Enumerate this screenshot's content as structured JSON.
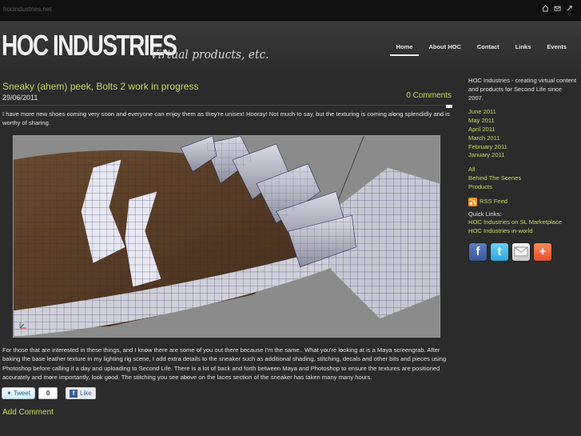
{
  "topbar": {
    "site": "hocindustries.net",
    "icons": [
      "home-icon",
      "mail-icon",
      "link-icon"
    ]
  },
  "header": {
    "logo": "HOC INDUSTRIES",
    "tagline": "Virtual products, etc.",
    "nav": [
      "Home",
      "About HOC",
      "Contact",
      "Links",
      "Events"
    ],
    "active_nav": "Home"
  },
  "post": {
    "title": "Sneaky (ahem) peek, Bolts 2 work in progress",
    "date": "29/06/2011",
    "comments": "0 Comments",
    "intro": "I have more new shoes coming very soon and everyone can enjoy them as they're unisex! Hooray! Not much to say, but the texturing is coming along splendidly and is worthy of sharing.",
    "body": "For those that are interested in these things, and I know there are some of you out there because I'm the same.. What you're looking at is a Maya screengrab. After baking the base leather texture in my lighting rig scene, I add extra details to the sneaker such as additional shading, stitching, decals and other bits and pieces using Photoshop before calling it a day and uploading to Second Life. There is a lot of back and forth between Maya and Photoshop to ensure the textures are positioned accurately and more importantly, look good. The stitching you see above on the laces section of the sneaker has taken many many hours.",
    "tweet_label": "Tweet",
    "tweet_count": "0",
    "like_label": "Like",
    "add_comment": "Add Comment"
  },
  "sidebar": {
    "about": "HOC Industries - creating virtual content and products for Second Life since 2007.",
    "archive": [
      "June 2011",
      "May 2011",
      "April 2011",
      "March 2011",
      "February 2011",
      "January 2011"
    ],
    "categories": [
      "All",
      "Behind The Scenes",
      "Products"
    ],
    "rss": "RSS Feed",
    "quick_links_label": "Quick Links:",
    "quick_links": [
      "HOC Industries on SL Marketplace",
      "HOC Industries in-world"
    ],
    "social": [
      "facebook-icon",
      "twitter-icon",
      "email-icon",
      "add-icon"
    ]
  },
  "colors": {
    "accent": "#c9d95b",
    "background": "#2b2b2b"
  }
}
